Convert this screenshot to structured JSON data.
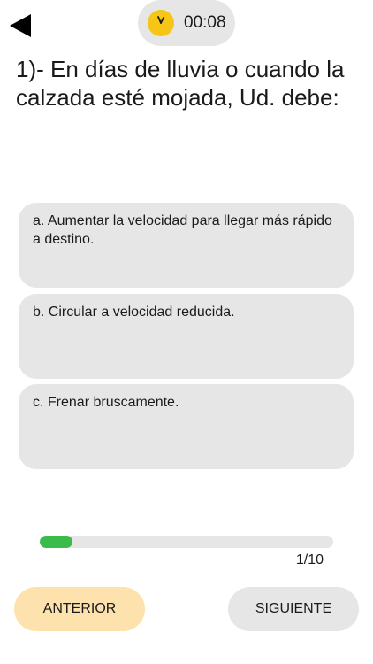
{
  "header": {
    "back_icon": "back-triangle-icon",
    "timer": {
      "icon": "clock-icon",
      "value": "00:08",
      "accent_color": "#f5c518"
    }
  },
  "question": {
    "text": "1)- En días de lluvia o cuando la calzada esté mojada, Ud. debe:"
  },
  "options": [
    {
      "text": "a. Aumentar la velocidad para llegar más rápido a destino."
    },
    {
      "text": "b. Circular a velocidad reducida."
    },
    {
      "text": "c. Frenar bruscamente."
    }
  ],
  "progress": {
    "current": 1,
    "total": 10,
    "label": "1/10",
    "fraction": 0.11,
    "fill_color": "#3bbb49"
  },
  "navigation": {
    "prev_label": "ANTERIOR",
    "next_label": "SIGUIENTE",
    "prev_color": "#fde2ad",
    "next_color": "#e6e6e6"
  }
}
